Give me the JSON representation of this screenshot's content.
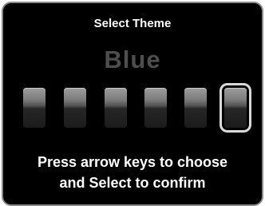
{
  "dialog": {
    "title": "Select Theme",
    "selected_theme": "Blue",
    "swatch_count": 6,
    "selected_index": 5,
    "hint_line1": "Press arrow keys to choose",
    "hint_line2": "and Select to confirm"
  },
  "colors": {
    "background": "#000000",
    "border": "#8a8a8a",
    "title": "#ffffff",
    "selected_name": "#4e4e4e",
    "selection_ring": "#d9d9d9"
  }
}
